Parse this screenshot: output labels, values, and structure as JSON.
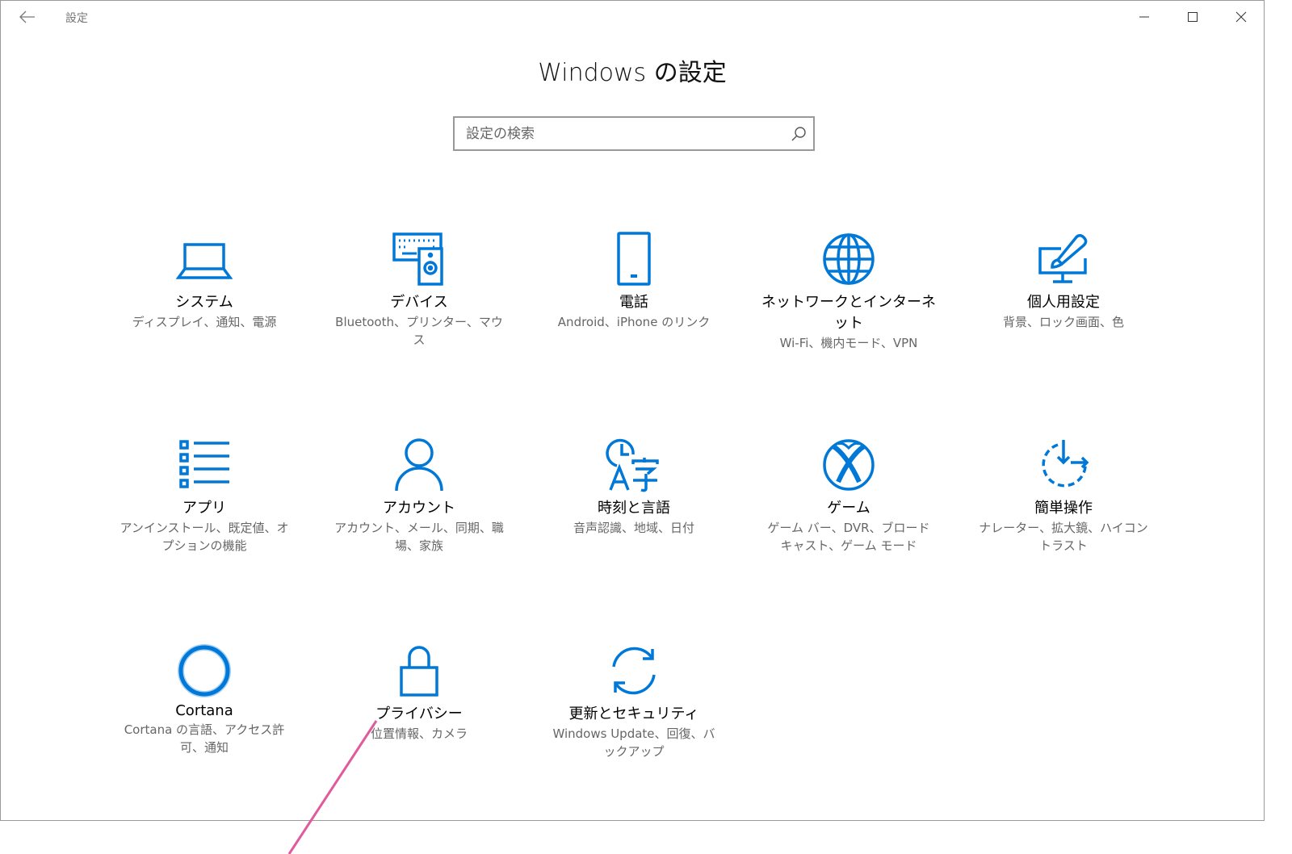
{
  "window": {
    "title": "設定"
  },
  "page": {
    "heading": "Windows の設定"
  },
  "search": {
    "placeholder": "設定の検索"
  },
  "colors": {
    "accent": "#0078d7",
    "annotation": "#e05a9c"
  },
  "tiles": [
    {
      "label": "システム",
      "desc": "ディスプレイ、通知、電源",
      "icon": "laptop-icon"
    },
    {
      "label": "デバイス",
      "desc": "Bluetooth、プリンター、マウス",
      "icon": "devices-icon"
    },
    {
      "label": "電話",
      "desc": "Android、iPhone のリンク",
      "icon": "phone-icon"
    },
    {
      "label": "ネットワークとインターネット",
      "desc": "Wi-Fi、機内モード、VPN",
      "icon": "globe-icon"
    },
    {
      "label": "個人用設定",
      "desc": "背景、ロック画面、色",
      "icon": "personalization-icon"
    },
    {
      "label": "アプリ",
      "desc": "アンインストール、既定値、オプションの機能",
      "icon": "apps-list-icon"
    },
    {
      "label": "アカウント",
      "desc": "アカウント、メール、同期、職場、家族",
      "icon": "person-icon"
    },
    {
      "label": "時刻と言語",
      "desc": "音声認識、地域、日付",
      "icon": "time-language-icon"
    },
    {
      "label": "ゲーム",
      "desc": "ゲーム バー、DVR、ブロードキャスト、ゲーム モード",
      "icon": "xbox-icon"
    },
    {
      "label": "簡単操作",
      "desc": "ナレーター、拡大鏡、ハイコントラスト",
      "icon": "ease-of-access-icon"
    },
    {
      "label": "Cortana",
      "desc": "Cortana の言語、アクセス許可、通知",
      "icon": "cortana-icon"
    },
    {
      "label": "プライバシー",
      "desc": "位置情報、カメラ",
      "icon": "lock-icon"
    },
    {
      "label": "更新とセキュリティ",
      "desc": "Windows Update、回復、バックアップ",
      "icon": "update-icon"
    }
  ]
}
